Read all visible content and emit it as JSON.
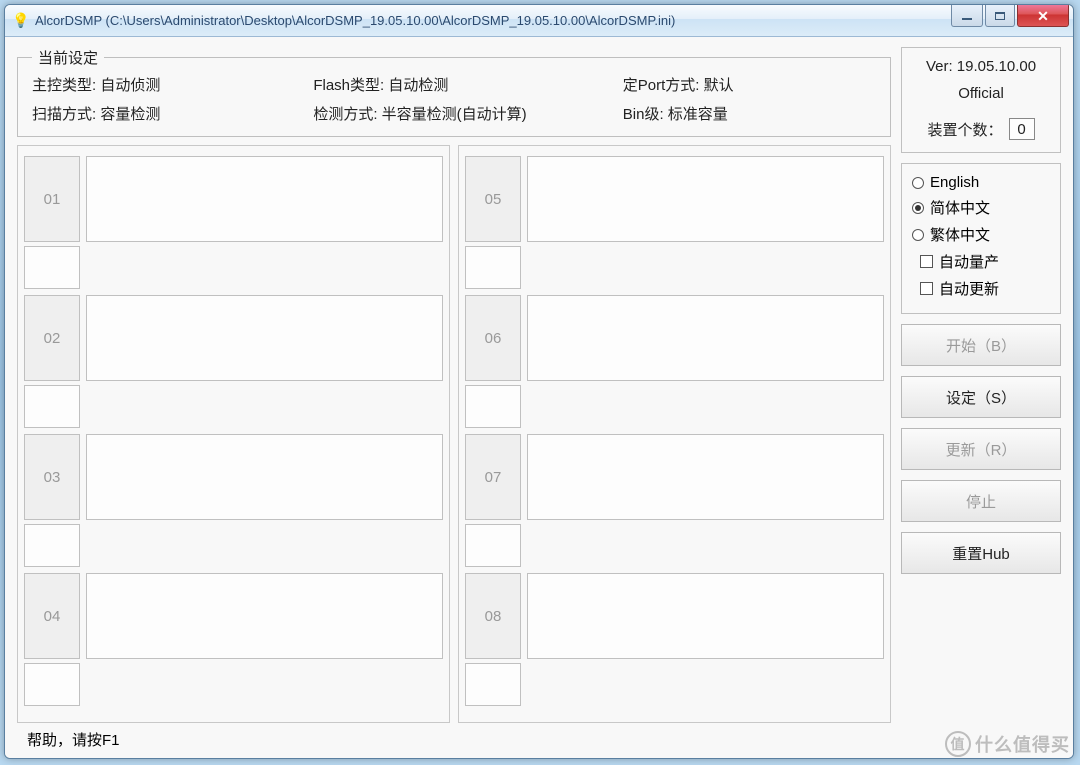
{
  "window": {
    "title": "AlcorDSMP (C:\\Users\\Administrator\\Desktop\\AlcorDSMP_19.05.10.00\\AlcorDSMP_19.05.10.00\\AlcorDSMP.ini)",
    "icon_glyph": "💡"
  },
  "settings": {
    "legend": "当前设定",
    "row1": {
      "c1": "主控类型: 自动侦测",
      "c2": "Flash类型: 自动检测",
      "c3": "定Port方式: 默认"
    },
    "row2": {
      "c1": "扫描方式: 容量检测",
      "c2": "检测方式: 半容量检测(自动计算)",
      "c3": "Bin级: 标准容量"
    }
  },
  "slots": {
    "left": [
      "01",
      "02",
      "03",
      "04"
    ],
    "right": [
      "05",
      "06",
      "07",
      "08"
    ]
  },
  "version": {
    "line": "Ver: 19.05.10.00",
    "official": "Official",
    "device_count_label": "装置个数：",
    "device_count_value": "0"
  },
  "language": {
    "english": "English",
    "simplified": "简体中文",
    "traditional": "繁体中文",
    "selected": "simplified"
  },
  "checks": {
    "auto_mp": "自动量产",
    "auto_update": "自动更新"
  },
  "buttons": {
    "start": "开始（B）",
    "setting": "设定（S）",
    "refresh": "更新（R）",
    "stop": "停止",
    "resethub": "重置Hub"
  },
  "help_bar": "帮助，请按F1",
  "watermark": "什么值得买"
}
